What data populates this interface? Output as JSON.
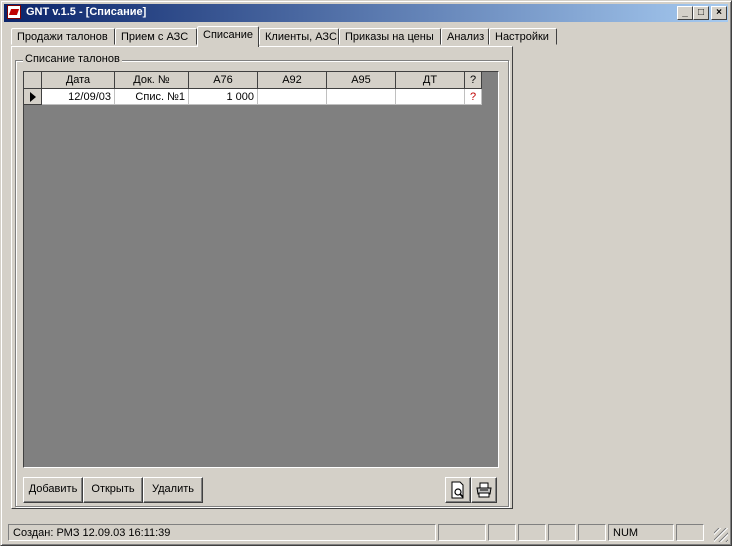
{
  "window": {
    "title": "GNT v.1.5 - [Списание]",
    "controls": {
      "minimize": "_",
      "maximize": "□",
      "close": "×"
    }
  },
  "tabs": [
    "Продажи талонов",
    "Прием с АЗС",
    "Списание",
    "Клиенты, АЗС",
    "Приказы на цены",
    "Анализ",
    "Настройки"
  ],
  "active_tab": "Списание",
  "group": {
    "caption": "Списание талонов"
  },
  "grid": {
    "columns": [
      "Дата",
      "Док. №",
      "A76",
      "A92",
      "A95",
      "ДТ",
      "?"
    ],
    "rows": [
      {
        "date": "12/09/03",
        "doc": "Спис. №1",
        "a76": "1 000",
        "a92": "",
        "a95": "",
        "dt": "",
        "flag": "?"
      }
    ]
  },
  "buttons": {
    "add": "Добавить",
    "open": "Открыть",
    "delete": "Удалить"
  },
  "icons": {
    "preview": "print-preview-icon",
    "print": "printer-icon"
  },
  "statusbar": {
    "text": "Создан: РМЗ 12.09.03 16:11:39",
    "num": "NUM"
  },
  "colors": {
    "title_start": "#0a246a",
    "title_end": "#a6caf0",
    "face": "#d4d0c8",
    "grid_bg": "#808080",
    "flag": "#c00000"
  }
}
